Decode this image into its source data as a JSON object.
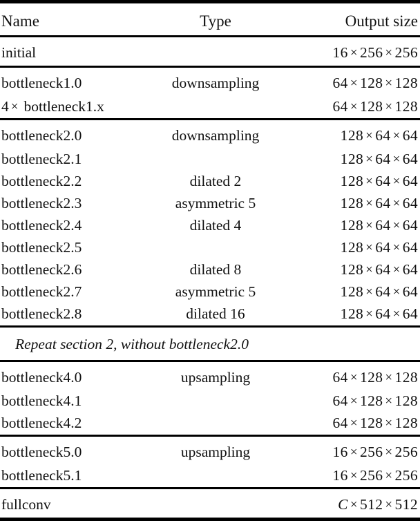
{
  "table": {
    "headers": {
      "name": "Name",
      "type": "Type",
      "output_size": "Output size"
    },
    "sections": [
      {
        "rows": [
          {
            "name": "initial",
            "type": "",
            "output": "16 × 256 × 256"
          }
        ]
      },
      {
        "rows": [
          {
            "name": "bottleneck1.0",
            "type": "downsampling",
            "output": "64 × 128 × 128"
          },
          {
            "name": "4× bottleneck1.x",
            "type": "",
            "output": "64 × 128 × 128"
          }
        ]
      },
      {
        "rows": [
          {
            "name": "bottleneck2.0",
            "type": "downsampling",
            "output": "128 × 64 × 64"
          },
          {
            "name": "bottleneck2.1",
            "type": "",
            "output": "128 × 64 × 64"
          },
          {
            "name": "bottleneck2.2",
            "type": "dilated 2",
            "output": "128 × 64 × 64"
          },
          {
            "name": "bottleneck2.3",
            "type": "asymmetric 5",
            "output": "128 × 64 × 64"
          },
          {
            "name": "bottleneck2.4",
            "type": "dilated 4",
            "output": "128 × 64 × 64"
          },
          {
            "name": "bottleneck2.5",
            "type": "",
            "output": "128 × 64 × 64"
          },
          {
            "name": "bottleneck2.6",
            "type": "dilated 8",
            "output": "128 × 64 × 64"
          },
          {
            "name": "bottleneck2.7",
            "type": "asymmetric 5",
            "output": "128 × 64 × 64"
          },
          {
            "name": "bottleneck2.8",
            "type": "dilated 16",
            "output": "128 × 64 × 64"
          }
        ]
      },
      {
        "span_note": "Repeat section 2, without bottleneck2.0"
      },
      {
        "rows": [
          {
            "name": "bottleneck4.0",
            "type": "upsampling",
            "output": "64 × 128 × 128"
          },
          {
            "name": "bottleneck4.1",
            "type": "",
            "output": "64 × 128 × 128"
          },
          {
            "name": "bottleneck4.2",
            "type": "",
            "output": "64 × 128 × 128"
          }
        ]
      },
      {
        "rows": [
          {
            "name": "bottleneck5.0",
            "type": "upsampling",
            "output": "16 × 256 × 256"
          },
          {
            "name": "bottleneck5.1",
            "type": "",
            "output": "16 × 256 × 256"
          }
        ]
      },
      {
        "rows": [
          {
            "name": "fullconv",
            "type": "",
            "output": "C × 512 × 512"
          }
        ]
      }
    ]
  }
}
